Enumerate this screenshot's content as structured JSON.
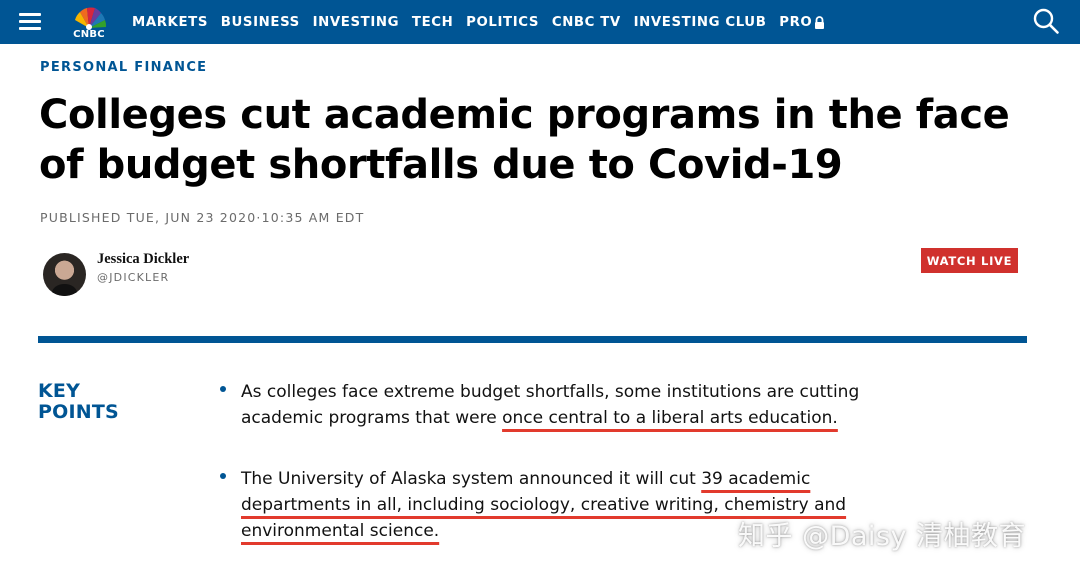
{
  "colors": {
    "brand_blue": "#005594",
    "watch_live_red": "#d0312d",
    "highlight_underline": "#e23a2d"
  },
  "nav": {
    "logo_text": "CNBC",
    "items": [
      "MARKETS",
      "BUSINESS",
      "INVESTING",
      "TECH",
      "POLITICS",
      "CNBC TV",
      "INVESTING CLUB"
    ],
    "pro_label": "PRO",
    "icons": {
      "menu": "hamburger-icon",
      "pro": "lock-icon",
      "search": "search-icon"
    }
  },
  "article": {
    "kicker": "PERSONAL FINANCE",
    "headline": "Colleges cut academic programs in the face of budget shortfalls due to Covid-19",
    "published": "PUBLISHED TUE, JUN 23 2020·10:35 AM EDT",
    "author": {
      "name": "Jessica Dickler",
      "handle": "@JDICKLER"
    },
    "watch_live": "WATCH LIVE"
  },
  "key_points": {
    "title_line1": "KEY",
    "title_line2": "POINTS",
    "items": [
      {
        "before": "As colleges face extreme budget shortfalls, some institutions are cutting academic programs that were ",
        "highlight": "once central to a liberal arts education."
      },
      {
        "before": "The University of Alaska system announced it will cut ",
        "highlight": "39 academic departments in all, including sociology, creative writing, chemistry and environmental science."
      }
    ]
  },
  "watermark": "知乎 @Daisy 清柚教育"
}
